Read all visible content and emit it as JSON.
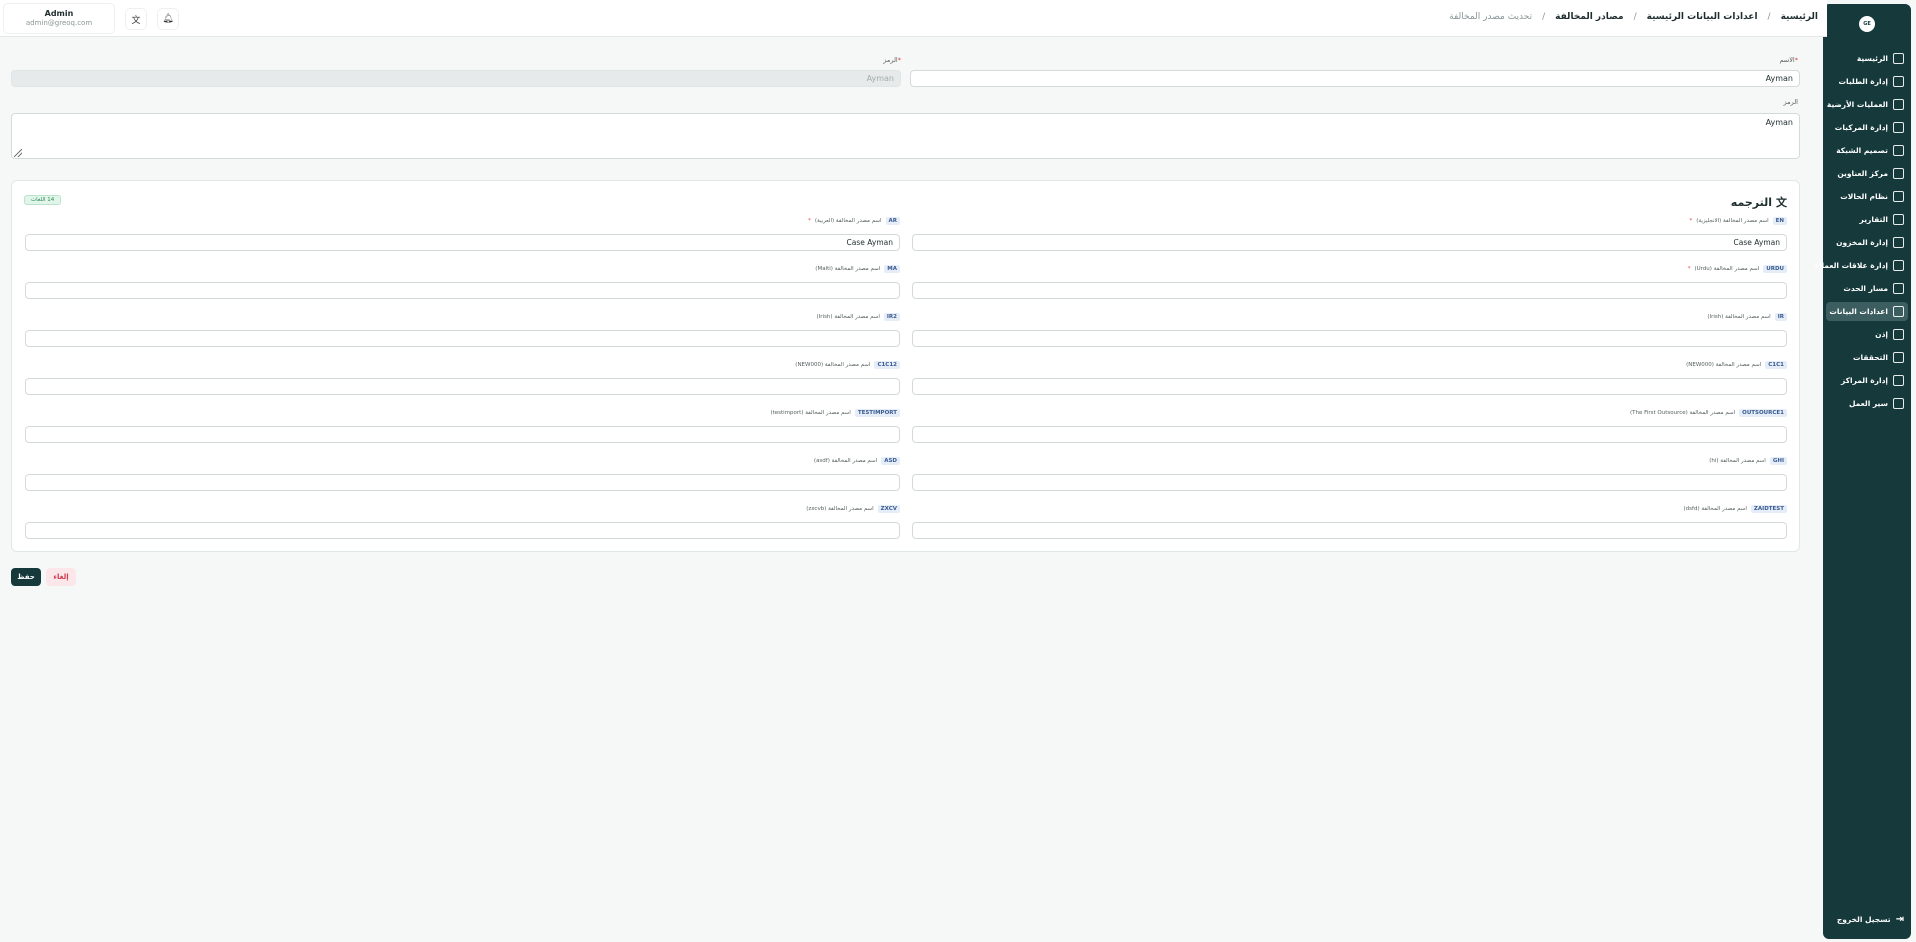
{
  "user": {
    "name": "Admin",
    "email": "admin@greoq.com"
  },
  "breadcrumb": {
    "home": "الرئيسية",
    "master": "اعدادات البيانات الرئيسية",
    "list": "مصادر المخالفة",
    "current": "تحديث مصدر المخالفة",
    "sep": "/"
  },
  "sidebar": {
    "logo": "GE",
    "items": [
      {
        "label": "الرئيسية"
      },
      {
        "label": "إدارة الطلبات"
      },
      {
        "label": "العمليات الأرضية"
      },
      {
        "label": "إدارة المركبات"
      },
      {
        "label": "تصميم الشبكة"
      },
      {
        "label": "مركز العناوين"
      },
      {
        "label": "نظام الحالات"
      },
      {
        "label": "التقارير"
      },
      {
        "label": "إدارة المخزون"
      },
      {
        "label": "إدارة علاقات العملاء"
      },
      {
        "label": "مسار الحدث"
      },
      {
        "label": "اعدادات البيانات"
      },
      {
        "label": "إذن"
      },
      {
        "label": "التحققات"
      },
      {
        "label": "إدارة المراكز"
      },
      {
        "label": "سير العمل"
      }
    ],
    "logout": "تسجيل الخروج"
  },
  "form": {
    "name_label": "الاسم",
    "name_value": "Ayman",
    "code_label": "الرمز",
    "code_value": "Ayman",
    "desc_label": "الرمز",
    "desc_value": "Ayman"
  },
  "translation": {
    "title": "الترجمه",
    "count": "14 اللغات",
    "fields": [
      {
        "code": "EN",
        "label": "اسم مصدر المخالفة (الانجليزية)",
        "required": true,
        "value": "Case Ayman"
      },
      {
        "code": "AR",
        "label": "اسم مصدر المخالفة (العربية)",
        "required": true,
        "value": "Case Ayman"
      },
      {
        "code": "URDU",
        "label": "اسم مصدر المخالفة (Urdu)",
        "required": true,
        "value": ""
      },
      {
        "code": "MA",
        "label": "اسم مصدر المخالفة (Malti)",
        "required": false,
        "value": ""
      },
      {
        "code": "IR",
        "label": "اسم مصدر المخالفة (Irish)",
        "required": false,
        "value": ""
      },
      {
        "code": "IR2",
        "label": "اسم مصدر المخالفة (Irish)",
        "required": false,
        "value": ""
      },
      {
        "code": "C1C1",
        "label": "اسم مصدر المخالفة (NEW000)",
        "required": false,
        "value": ""
      },
      {
        "code": "C1C12",
        "label": "اسم مصدر المخالفة (NEW000)",
        "required": false,
        "value": ""
      },
      {
        "code": "OUTSOURCE1",
        "label": "اسم مصدر المخالفة (The First Outsource)",
        "required": false,
        "value": ""
      },
      {
        "code": "TESTIMPORT",
        "label": "اسم مصدر المخالفة (testimport)",
        "required": false,
        "value": ""
      },
      {
        "code": "GHI",
        "label": "اسم مصدر المخالفة (hi)",
        "required": false,
        "value": ""
      },
      {
        "code": "ASD",
        "label": "اسم مصدر المخالفة (asdf)",
        "required": false,
        "value": ""
      },
      {
        "code": "ZAIDTEST",
        "label": "اسم مصدر المخالفة (dsfd)",
        "required": false,
        "value": ""
      },
      {
        "code": "ZXCV",
        "label": "اسم مصدر المخالفة (zxcvb)",
        "required": false,
        "value": ""
      }
    ]
  },
  "actions": {
    "save": "حفظ",
    "cancel": "إلغاء"
  }
}
